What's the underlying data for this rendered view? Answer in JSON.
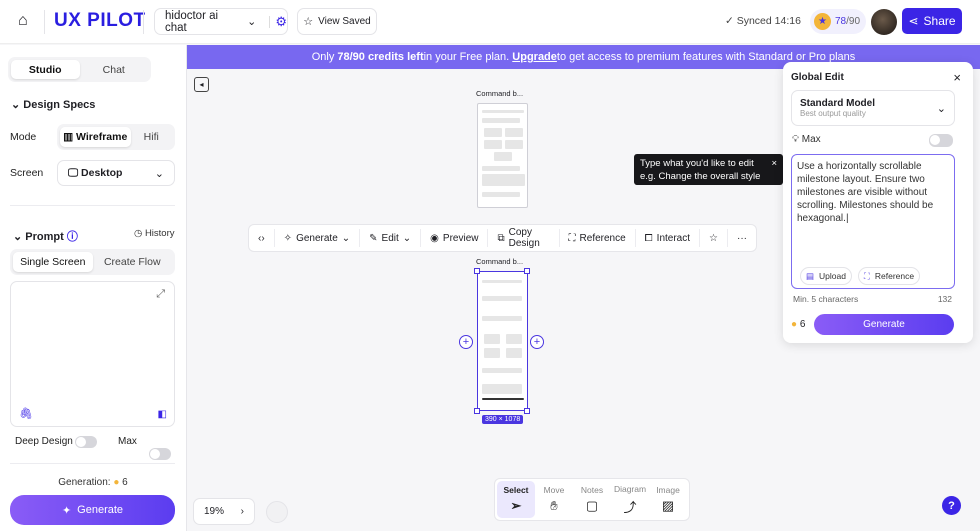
{
  "header": {
    "brand": "UX PILOT",
    "project": "hidoctor ai chat",
    "view_saved": "View Saved",
    "synced": "Synced 14:16",
    "credits_used": "78",
    "credits_total": "/90",
    "share": "Share"
  },
  "banner": {
    "prefix": "Only ",
    "credits": "78/90 credits left",
    "middle": " in your Free plan. ",
    "upgrade": "Upgrade",
    "suffix": " to get access to premium features with Standard or Pro plans"
  },
  "sidebar": {
    "tabs": [
      "Studio",
      "Chat"
    ],
    "design_specs": "Design Specs",
    "mode_label": "Mode",
    "modes": [
      "Wireframe",
      "Hifi"
    ],
    "screen_label": "Screen",
    "screen_value": "Desktop",
    "prompt": "Prompt",
    "history": "History",
    "prompt_tabs": [
      "Single Screen",
      "Create Flow"
    ],
    "prompt_value": "",
    "deep_design": "Deep Design",
    "max": "Max",
    "generation_label": "Generation:",
    "generation_cost": "6",
    "generate": "Generate"
  },
  "canvas": {
    "frame1_label": "Command b...",
    "frame2_label": "Command b...",
    "frame2_size": "390 × 1078",
    "zoom": "19%"
  },
  "toolbar": {
    "generate": "Generate",
    "edit": "Edit",
    "preview": "Preview",
    "copy_design": "Copy Design",
    "reference": "Reference",
    "interact": "Interact"
  },
  "tooltip": {
    "line1": "Type what you'd like to edit",
    "line2": "e.g. Change the overall style"
  },
  "global_edit": {
    "title": "Global Edit",
    "model": "Standard Model",
    "model_sub": "Best output quality",
    "max": "Max",
    "prompt": "Use a horizontally scrollable milestone layout. Ensure two milestones are visible without scrolling. Milestones should be hexagonal.",
    "upload": "Upload",
    "reference": "Reference",
    "min_chars": "Min. 5 characters",
    "char_count": "132",
    "cost": "6",
    "generate": "Generate"
  },
  "dock": [
    "Select",
    "Move",
    "Notes",
    "Diagram",
    "Image"
  ],
  "help": "?",
  "colors": {
    "accent": "#3b25e6",
    "banner": "#7868f0"
  }
}
